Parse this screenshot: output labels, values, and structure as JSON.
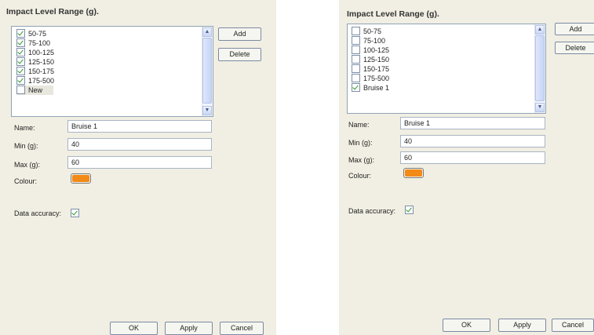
{
  "panels": [
    {
      "title": "Impact Level Range (g).",
      "items": [
        {
          "label": "50-75",
          "checked": true
        },
        {
          "label": "75-100",
          "checked": true
        },
        {
          "label": "100-125",
          "checked": true
        },
        {
          "label": "125-150",
          "checked": true
        },
        {
          "label": "150-175",
          "checked": true
        },
        {
          "label": "175-500",
          "checked": true
        },
        {
          "label": "New",
          "checked": false
        }
      ],
      "buttons": {
        "add": "Add",
        "delete": "Delete",
        "ok": "OK",
        "apply": "Apply",
        "cancel": "Cancel"
      },
      "fields": {
        "name": {
          "label": "Name:",
          "value": "Bruise 1"
        },
        "min": {
          "label": "Min (g):",
          "value": "40"
        },
        "max": {
          "label": "Max (g):",
          "value": "60"
        },
        "colour": {
          "label": "Colour:",
          "value": "#f28a17"
        },
        "accuracy": {
          "label": "Data accuracy:",
          "checked": true
        }
      }
    },
    {
      "title": "Impact Level Range (g).",
      "items": [
        {
          "label": "50-75",
          "checked": false
        },
        {
          "label": "75-100",
          "checked": false
        },
        {
          "label": "100-125",
          "checked": false
        },
        {
          "label": "125-150",
          "checked": false
        },
        {
          "label": "150-175",
          "checked": false
        },
        {
          "label": "175-500",
          "checked": false
        },
        {
          "label": "Bruise 1",
          "checked": true
        }
      ],
      "buttons": {
        "add": "Add",
        "delete": "Delete",
        "ok": "OK",
        "apply": "Apply",
        "cancel": "Cancel"
      },
      "fields": {
        "name": {
          "label": "Name:",
          "value": "Bruise 1"
        },
        "min": {
          "label": "Min (g):",
          "value": "40"
        },
        "max": {
          "label": "Max (g):",
          "value": "60"
        },
        "colour": {
          "label": "Colour:",
          "value": "#f28a17"
        },
        "accuracy": {
          "label": "Data accuracy:",
          "checked": true
        }
      }
    }
  ]
}
